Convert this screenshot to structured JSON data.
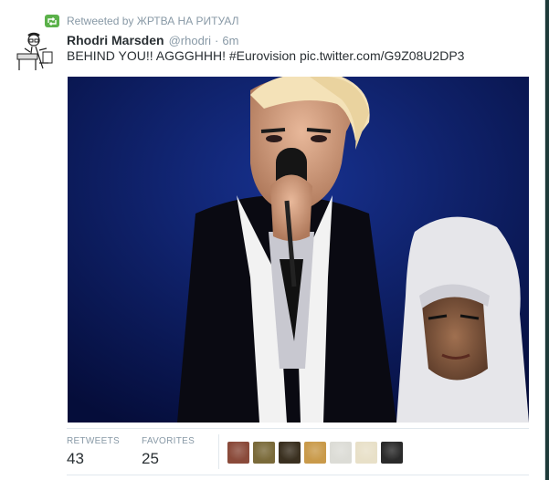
{
  "retweet": {
    "prefix": "Retweeted by",
    "user": "ЖРТВА НА РИТУАЛ"
  },
  "tweet": {
    "name": "Rhodri Marsden",
    "handle": "@rhodri",
    "dot": "·",
    "time": "6m",
    "text_plain": "BEHIND YOU!! AGGGHHH! ",
    "hashtag": "#Eurovision",
    "link": "pic.twitter.com/G9Z08U2DP3"
  },
  "stats": {
    "retweets_label": "RETWEETS",
    "retweets_value": "43",
    "favorites_label": "FAVORITES",
    "favorites_value": "25"
  },
  "favoriters": [
    {
      "name": "avatar-1",
      "color": "#8a4a3a"
    },
    {
      "name": "avatar-2",
      "color": "#7a6a3a"
    },
    {
      "name": "avatar-3",
      "color": "#3a3020"
    },
    {
      "name": "avatar-4",
      "color": "#c99a4a"
    },
    {
      "name": "avatar-5",
      "color": "#dcdcd6"
    },
    {
      "name": "avatar-6",
      "color": "#e8e0c8"
    },
    {
      "name": "avatar-7",
      "color": "#2a2a2a"
    }
  ]
}
